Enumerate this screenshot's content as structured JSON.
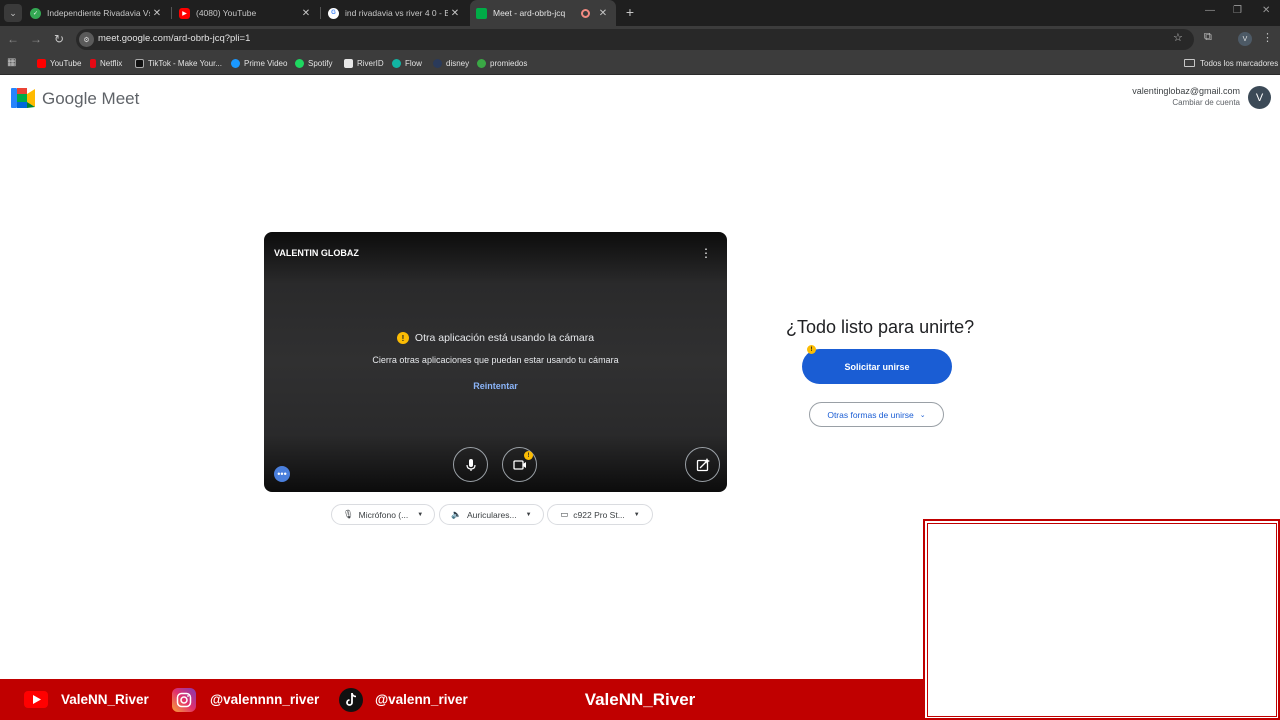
{
  "browser": {
    "tabs": [
      {
        "title": "Independiente Rivadavia Vs Riv",
        "close": "✕"
      },
      {
        "title": "(4080) YouTube",
        "close": "✕"
      },
      {
        "title": "ind rivadavia vs river 4 0 - Busc",
        "close": "✕"
      },
      {
        "title": "Meet - ard-obrb-jcq",
        "close": "✕"
      }
    ],
    "url": "meet.google.com/ard-obrb-jcq?pli=1",
    "profile_initial": "V",
    "bookmarks": [
      "YouTube",
      "Netflix",
      "TikTok - Make Your...",
      "Prime Video",
      "Spotify",
      "RiverID",
      "Flow",
      "disney",
      "promiedos"
    ],
    "all_bookmarks": "Todos los marcadores"
  },
  "meet": {
    "brand": "Google Meet",
    "account_email": "valentinglobaz@gmail.com",
    "switch_account": "Cambiar de cuenta",
    "avatar_initial": "V",
    "preview": {
      "name": "VALENTIN GLOBAZ",
      "warning_title": "Otra aplicación está usando la cámara",
      "warning_body": "Cierra otras aplicaciones que puedan estar usando tu cámara",
      "retry": "Reintentar"
    },
    "devices": {
      "mic": "Micrófono (...",
      "speaker": "Auriculares...",
      "camera": "c922 Pro St..."
    },
    "join": {
      "title": "¿Todo listo para unirte?",
      "ask_join": "Solicitar unirse",
      "other_ways": "Otras formas de unirse"
    }
  },
  "overlay": {
    "youtube": "ValeNN_River",
    "instagram": "@valennnn_river",
    "tiktok": "@valenn_river",
    "center": "ValeNN_River",
    "accent_color": "#c00000"
  }
}
